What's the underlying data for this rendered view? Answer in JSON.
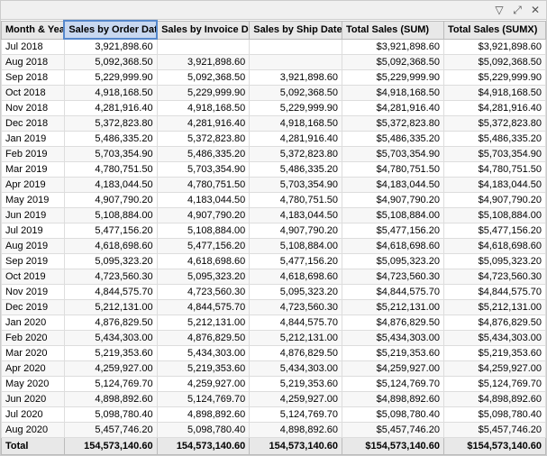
{
  "toolbar": {
    "filter_icon": "▽",
    "expand_icon": "⤢",
    "close_icon": "✕"
  },
  "columns": [
    {
      "key": "month",
      "label": "Month & Year",
      "selected": false
    },
    {
      "key": "order",
      "label": "Sales by Order Date",
      "selected": true
    },
    {
      "key": "invoice",
      "label": "Sales by Invoice Date",
      "selected": false
    },
    {
      "key": "ship",
      "label": "Sales by Ship Date",
      "selected": false
    },
    {
      "key": "total_sum",
      "label": "Total Sales (SUM)",
      "selected": false
    },
    {
      "key": "total_sumx",
      "label": "Total Sales (SUMX)",
      "selected": false
    }
  ],
  "rows": [
    {
      "month": "Jul 2018",
      "order": "3,921,898.60",
      "invoice": "",
      "ship": "",
      "total_sum": "$3,921,898.60",
      "total_sumx": "$3,921,898.60"
    },
    {
      "month": "Aug 2018",
      "order": "5,092,368.50",
      "invoice": "3,921,898.60",
      "ship": "",
      "total_sum": "$5,092,368.50",
      "total_sumx": "$5,092,368.50"
    },
    {
      "month": "Sep 2018",
      "order": "5,229,999.90",
      "invoice": "5,092,368.50",
      "ship": "3,921,898.60",
      "total_sum": "$5,229,999.90",
      "total_sumx": "$5,229,999.90"
    },
    {
      "month": "Oct 2018",
      "order": "4,918,168.50",
      "invoice": "5,229,999.90",
      "ship": "5,092,368.50",
      "total_sum": "$4,918,168.50",
      "total_sumx": "$4,918,168.50"
    },
    {
      "month": "Nov 2018",
      "order": "4,281,916.40",
      "invoice": "4,918,168.50",
      "ship": "5,229,999.90",
      "total_sum": "$4,281,916.40",
      "total_sumx": "$4,281,916.40"
    },
    {
      "month": "Dec 2018",
      "order": "5,372,823.80",
      "invoice": "4,281,916.40",
      "ship": "4,918,168.50",
      "total_sum": "$5,372,823.80",
      "total_sumx": "$5,372,823.80"
    },
    {
      "month": "Jan 2019",
      "order": "5,486,335.20",
      "invoice": "5,372,823.80",
      "ship": "4,281,916.40",
      "total_sum": "$5,486,335.20",
      "total_sumx": "$5,486,335.20"
    },
    {
      "month": "Feb 2019",
      "order": "5,703,354.90",
      "invoice": "5,486,335.20",
      "ship": "5,372,823.80",
      "total_sum": "$5,703,354.90",
      "total_sumx": "$5,703,354.90"
    },
    {
      "month": "Mar 2019",
      "order": "4,780,751.50",
      "invoice": "5,703,354.90",
      "ship": "5,486,335.20",
      "total_sum": "$4,780,751.50",
      "total_sumx": "$4,780,751.50"
    },
    {
      "month": "Apr 2019",
      "order": "4,183,044.50",
      "invoice": "4,780,751.50",
      "ship": "5,703,354.90",
      "total_sum": "$4,183,044.50",
      "total_sumx": "$4,183,044.50"
    },
    {
      "month": "May 2019",
      "order": "4,907,790.20",
      "invoice": "4,183,044.50",
      "ship": "4,780,751.50",
      "total_sum": "$4,907,790.20",
      "total_sumx": "$4,907,790.20"
    },
    {
      "month": "Jun 2019",
      "order": "5,108,884.00",
      "invoice": "4,907,790.20",
      "ship": "4,183,044.50",
      "total_sum": "$5,108,884.00",
      "total_sumx": "$5,108,884.00"
    },
    {
      "month": "Jul 2019",
      "order": "5,477,156.20",
      "invoice": "5,108,884.00",
      "ship": "4,907,790.20",
      "total_sum": "$5,477,156.20",
      "total_sumx": "$5,477,156.20"
    },
    {
      "month": "Aug 2019",
      "order": "4,618,698.60",
      "invoice": "5,477,156.20",
      "ship": "5,108,884.00",
      "total_sum": "$4,618,698.60",
      "total_sumx": "$4,618,698.60"
    },
    {
      "month": "Sep 2019",
      "order": "5,095,323.20",
      "invoice": "4,618,698.60",
      "ship": "5,477,156.20",
      "total_sum": "$5,095,323.20",
      "total_sumx": "$5,095,323.20"
    },
    {
      "month": "Oct 2019",
      "order": "4,723,560.30",
      "invoice": "5,095,323.20",
      "ship": "4,618,698.60",
      "total_sum": "$4,723,560.30",
      "total_sumx": "$4,723,560.30"
    },
    {
      "month": "Nov 2019",
      "order": "4,844,575.70",
      "invoice": "4,723,560.30",
      "ship": "5,095,323.20",
      "total_sum": "$4,844,575.70",
      "total_sumx": "$4,844,575.70"
    },
    {
      "month": "Dec 2019",
      "order": "5,212,131.00",
      "invoice": "4,844,575.70",
      "ship": "4,723,560.30",
      "total_sum": "$5,212,131.00",
      "total_sumx": "$5,212,131.00"
    },
    {
      "month": "Jan 2020",
      "order": "4,876,829.50",
      "invoice": "5,212,131.00",
      "ship": "4,844,575.70",
      "total_sum": "$4,876,829.50",
      "total_sumx": "$4,876,829.50"
    },
    {
      "month": "Feb 2020",
      "order": "5,434,303.00",
      "invoice": "4,876,829.50",
      "ship": "5,212,131.00",
      "total_sum": "$5,434,303.00",
      "total_sumx": "$5,434,303.00"
    },
    {
      "month": "Mar 2020",
      "order": "5,219,353.60",
      "invoice": "5,434,303.00",
      "ship": "4,876,829.50",
      "total_sum": "$5,219,353.60",
      "total_sumx": "$5,219,353.60"
    },
    {
      "month": "Apr 2020",
      "order": "4,259,927.00",
      "invoice": "5,219,353.60",
      "ship": "5,434,303.00",
      "total_sum": "$4,259,927.00",
      "total_sumx": "$4,259,927.00"
    },
    {
      "month": "May 2020",
      "order": "5,124,769.70",
      "invoice": "4,259,927.00",
      "ship": "5,219,353.60",
      "total_sum": "$5,124,769.70",
      "total_sumx": "$5,124,769.70"
    },
    {
      "month": "Jun 2020",
      "order": "4,898,892.60",
      "invoice": "5,124,769.70",
      "ship": "4,259,927.00",
      "total_sum": "$4,898,892.60",
      "total_sumx": "$4,898,892.60"
    },
    {
      "month": "Jul 2020",
      "order": "5,098,780.40",
      "invoice": "4,898,892.60",
      "ship": "5,124,769.70",
      "total_sum": "$5,098,780.40",
      "total_sumx": "$5,098,780.40"
    },
    {
      "month": "Aug 2020",
      "order": "5,457,746.20",
      "invoice": "5,098,780.40",
      "ship": "4,898,892.60",
      "total_sum": "$5,457,746.20",
      "total_sumx": "$5,457,746.20"
    }
  ],
  "footer": {
    "label": "Total",
    "order": "154,573,140.60",
    "invoice": "154,573,140.60",
    "ship": "154,573,140.60",
    "total_sum": "$154,573,140.60",
    "total_sumx": "$154,573,140.60"
  }
}
